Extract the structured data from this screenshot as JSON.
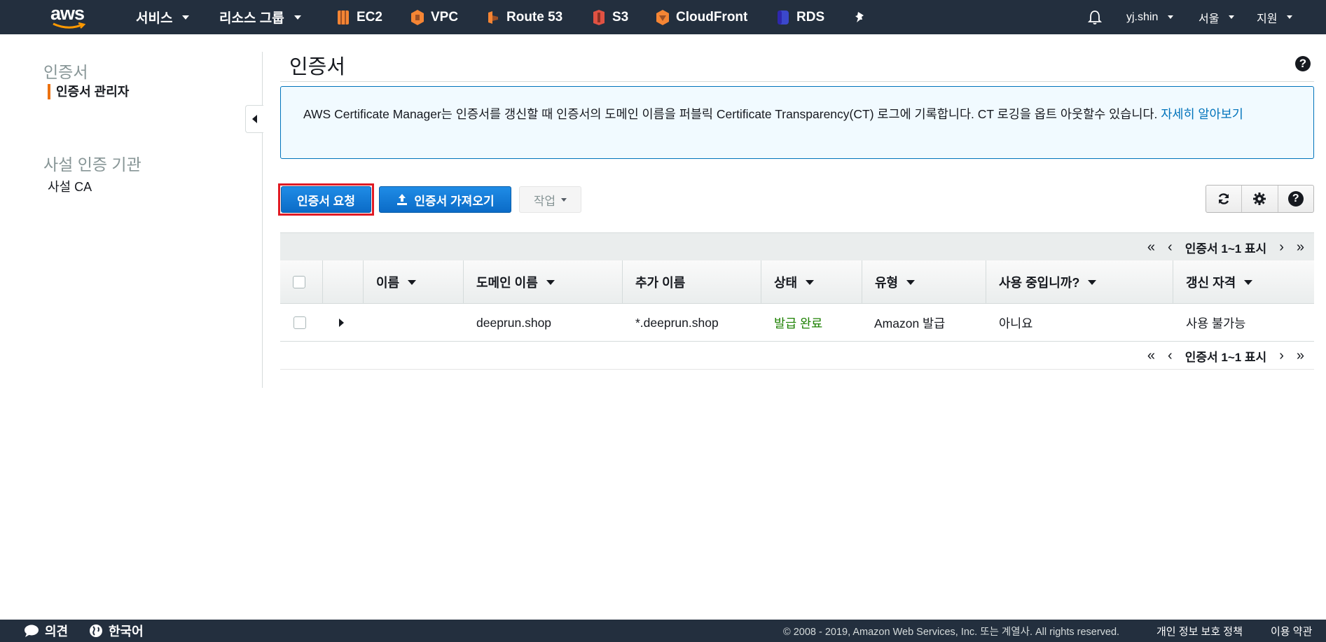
{
  "nav": {
    "logo": "aws",
    "services_label": "서비스",
    "resource_groups_label": "리소스 그룹",
    "shortcuts": [
      {
        "label": "EC2",
        "icon": "ec2-icon",
        "color": "#f58534"
      },
      {
        "label": "VPC",
        "icon": "vpc-icon",
        "color": "#f58534"
      },
      {
        "label": "Route 53",
        "icon": "route53-icon",
        "color": "#f58534"
      },
      {
        "label": "S3",
        "icon": "s3-icon",
        "color": "#e05243"
      },
      {
        "label": "CloudFront",
        "icon": "cloudfront-icon",
        "color": "#f58534"
      },
      {
        "label": "RDS",
        "icon": "rds-icon",
        "color": "#3b48cc"
      }
    ],
    "user": "yj.shin",
    "region": "서울",
    "support": "지원"
  },
  "sidebar": {
    "section1_title": "인증서",
    "section1_item": "인증서 관리자",
    "section2_title": "사설 인증 기관",
    "section2_item": "사설 CA"
  },
  "main": {
    "title": "인증서",
    "info_text": "AWS Certificate Manager는 인증서를 갱신할 때 인증서의 도메인 이름을 퍼블릭 Certificate Transparency(CT) 로그에 기록합니다. CT 로깅을 옵트 아웃할수 있습니다. ",
    "info_link": "자세히 알아보기",
    "request_button": "인증서 요청",
    "import_button": "인증서 가져오기",
    "actions_button": "작업",
    "pager_text": "인증서 1~1 표시"
  },
  "table": {
    "columns": [
      "이름",
      "도메인 이름",
      "추가 이름",
      "상태",
      "유형",
      "사용 중입니까?",
      "갱신 자격"
    ],
    "rows": [
      {
        "name": "",
        "domain": "deeprun.shop",
        "additional": "*.deeprun.shop",
        "status": "발급 완료",
        "type": "Amazon 발급",
        "in_use": "아니요",
        "renewal": "사용 불가능"
      }
    ]
  },
  "colors": {
    "status_issued": "#1d8102",
    "accent": "#ec7211",
    "link": "#0073bb"
  },
  "footer": {
    "feedback": "의견",
    "language": "한국어",
    "copyright": "© 2008 - 2019, Amazon Web Services, Inc. 또는 계열사. All rights reserved.",
    "privacy": "개인 정보 보호 정책",
    "terms": "이용 약관"
  }
}
